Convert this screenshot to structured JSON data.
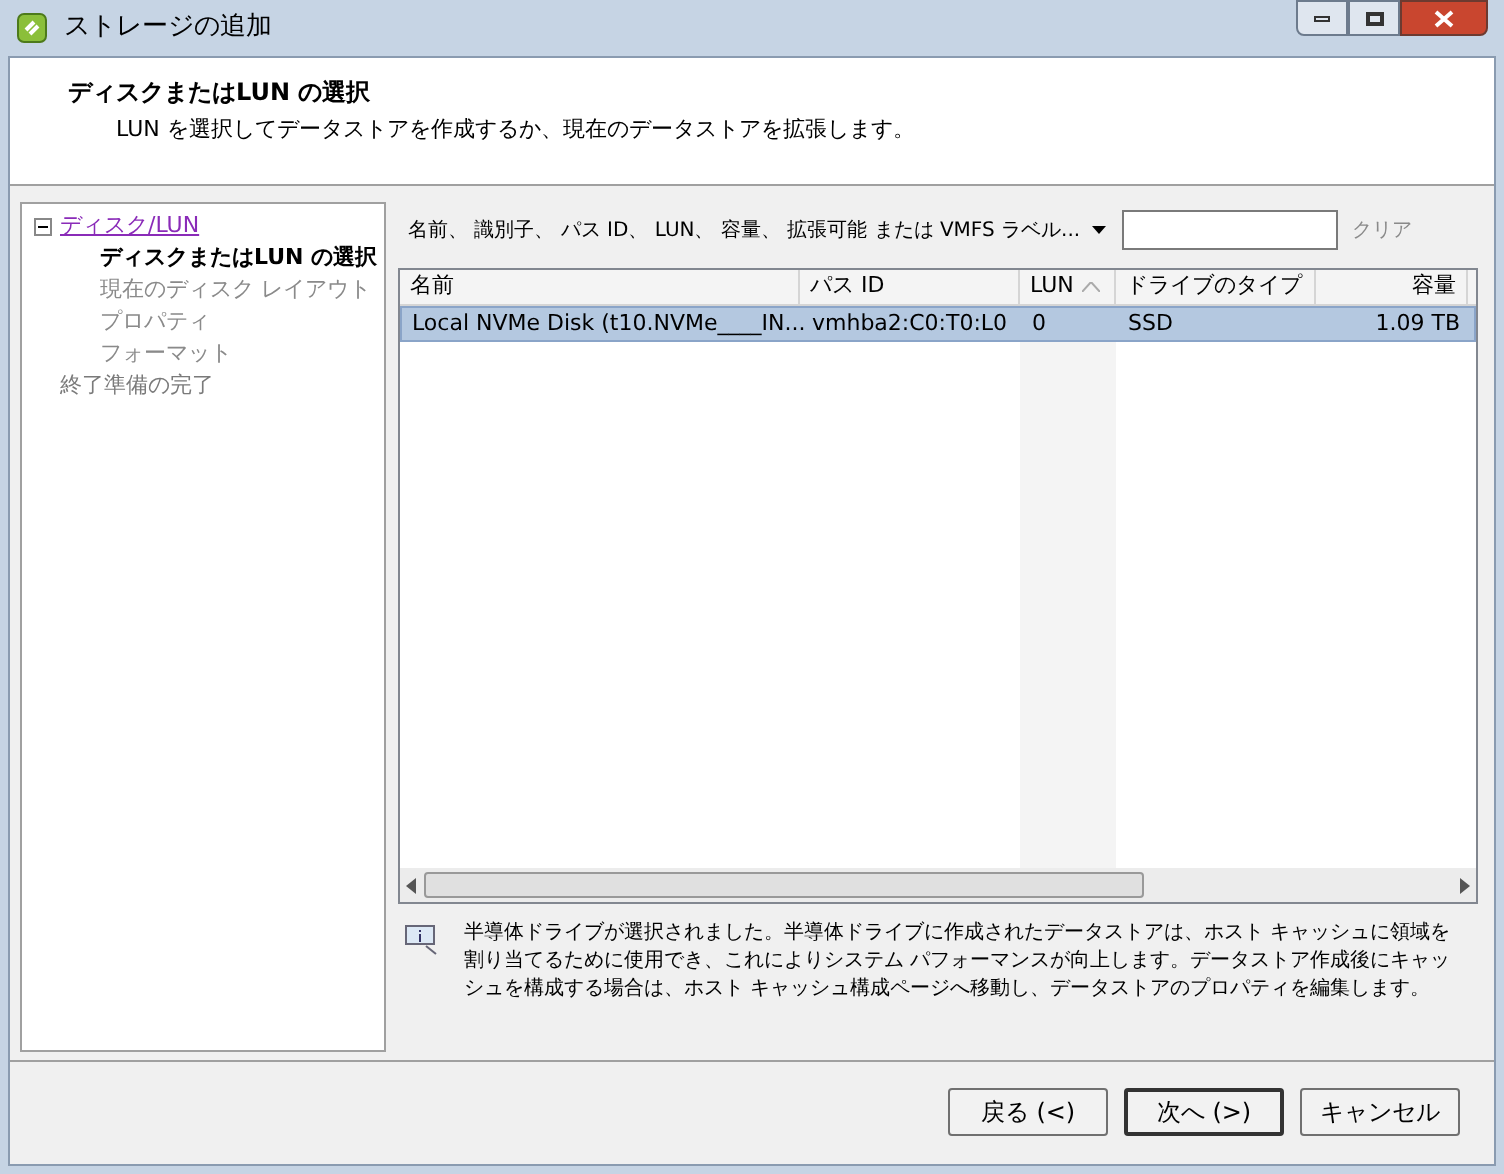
{
  "window": {
    "title": "ストレージの追加"
  },
  "header": {
    "title": "ディスクまたはLUN の選択",
    "subtitle": "LUN を選択してデータストアを作成するか、現在のデータストアを拡張します。"
  },
  "nav": [
    {
      "label": "ディスク/LUN",
      "kind": "link",
      "expanded": true,
      "children": [
        {
          "label": "ディスクまたはLUN の選択",
          "selected": true,
          "disabled": false
        },
        {
          "label": "現在のディスク レイアウト",
          "selected": false,
          "disabled": true
        },
        {
          "label": "プロパティ",
          "selected": false,
          "disabled": true
        },
        {
          "label": "フォーマット",
          "selected": false,
          "disabled": true
        }
      ]
    },
    {
      "label": "終了準備の完了",
      "kind": "step",
      "disabled": true
    }
  ],
  "filter": {
    "label": "名前、 識別子、 パス ID、 LUN、 容量、 拡張可能 または VMFS ラベル...",
    "clear": "クリア"
  },
  "table": {
    "columns": [
      {
        "label": "名前",
        "sorted": false,
        "kind": "text"
      },
      {
        "label": "パス ID",
        "sorted": false,
        "kind": "text"
      },
      {
        "label": "LUN",
        "sorted": true,
        "kind": "text"
      },
      {
        "label": "ドライブのタイプ",
        "sorted": false,
        "kind": "text"
      },
      {
        "label": "容量",
        "sorted": false,
        "kind": "number"
      }
    ],
    "rows": [
      {
        "selected": true,
        "cells": [
          "Local NVMe Disk (t10.NVMe____IN...",
          "vmhba2:C0:T0:L0",
          "0",
          "SSD",
          "1.09 TB"
        ]
      }
    ]
  },
  "info": "半導体ドライブが選択されました。半導体ドライブに作成されたデータストアは、ホスト キャッシュに領域を割り当てるために使用でき、これによりシステム パフォーマンスが向上します。データストア作成後にキャッシュを構成する場合は、ホスト キャッシュ構成ページへ移動し、データストアのプロパティを編集します。",
  "buttons": [
    {
      "label": "戻る (<)",
      "default": false
    },
    {
      "label": "次へ (>)",
      "default": true
    },
    {
      "label": "キャンセル",
      "default": false
    }
  ]
}
